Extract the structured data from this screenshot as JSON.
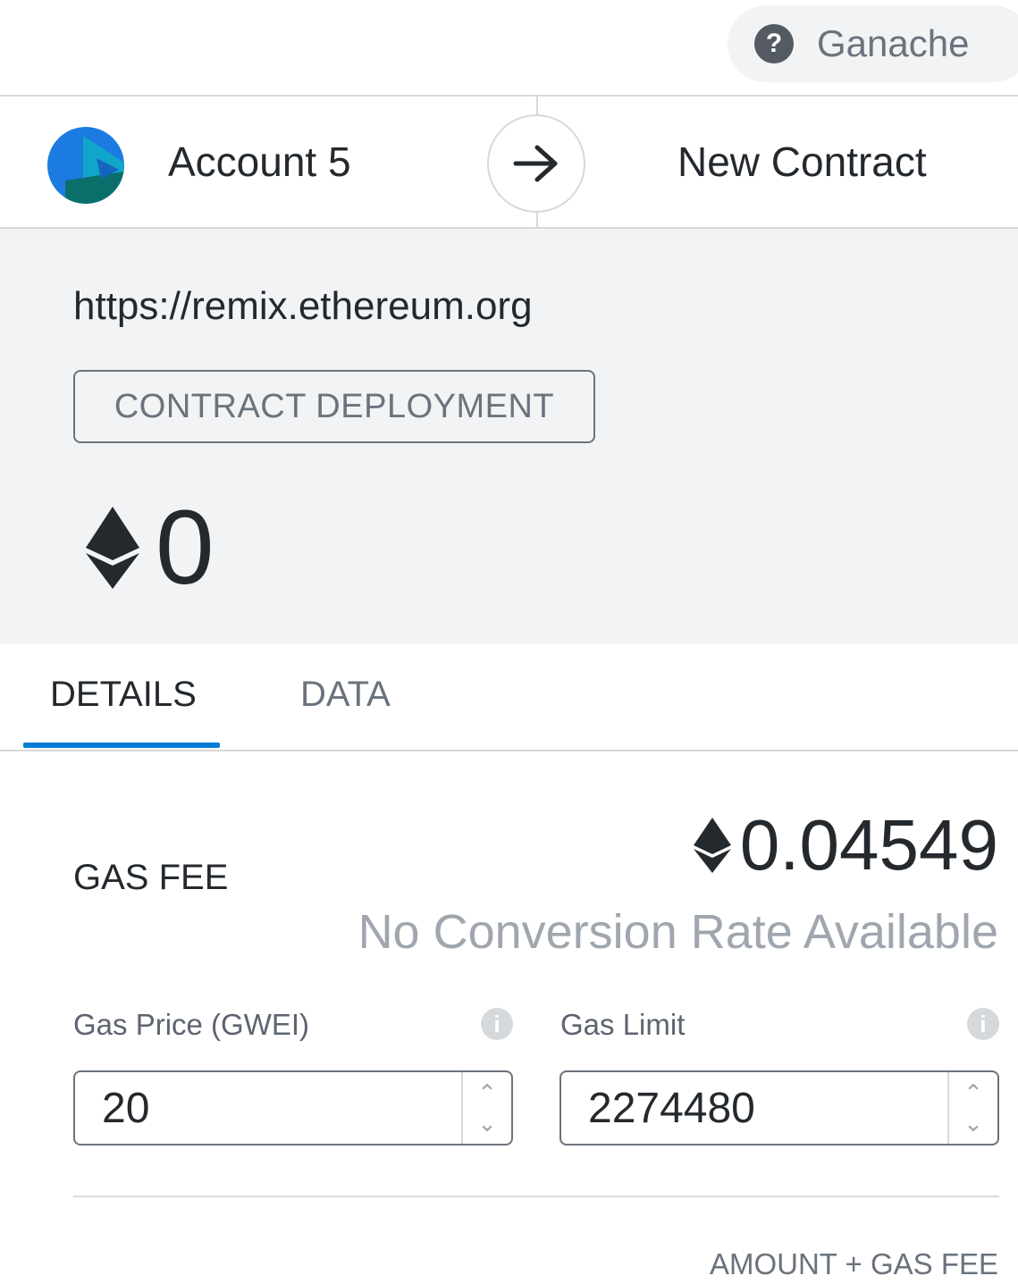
{
  "network": {
    "name": "Ganache",
    "icon": "question-icon"
  },
  "account": {
    "name": "Account 5",
    "avatar_colors": [
      "#1c7be0",
      "#0fa6c9",
      "#0a6f6b"
    ]
  },
  "recipient": {
    "name": "New Contract"
  },
  "summary": {
    "origin": "https://remix.ethereum.org",
    "action": "CONTRACT DEPLOYMENT",
    "amount": "0"
  },
  "tabs": [
    {
      "label": "DETAILS",
      "active": true
    },
    {
      "label": "DATA",
      "active": false
    }
  ],
  "gas": {
    "fee_label": "GAS FEE",
    "fee_value": "0.04549",
    "conversion": "No Conversion Rate Available",
    "price_label": "Gas Price (GWEI)",
    "price_value": "20",
    "limit_label": "Gas Limit",
    "limit_value": "2274480"
  },
  "total": {
    "label": "AMOUNT + GAS FEE"
  },
  "colors": {
    "accent": "#037dd6",
    "summary_bg": "#f2f3f4",
    "muted_text": "#6a737d"
  }
}
